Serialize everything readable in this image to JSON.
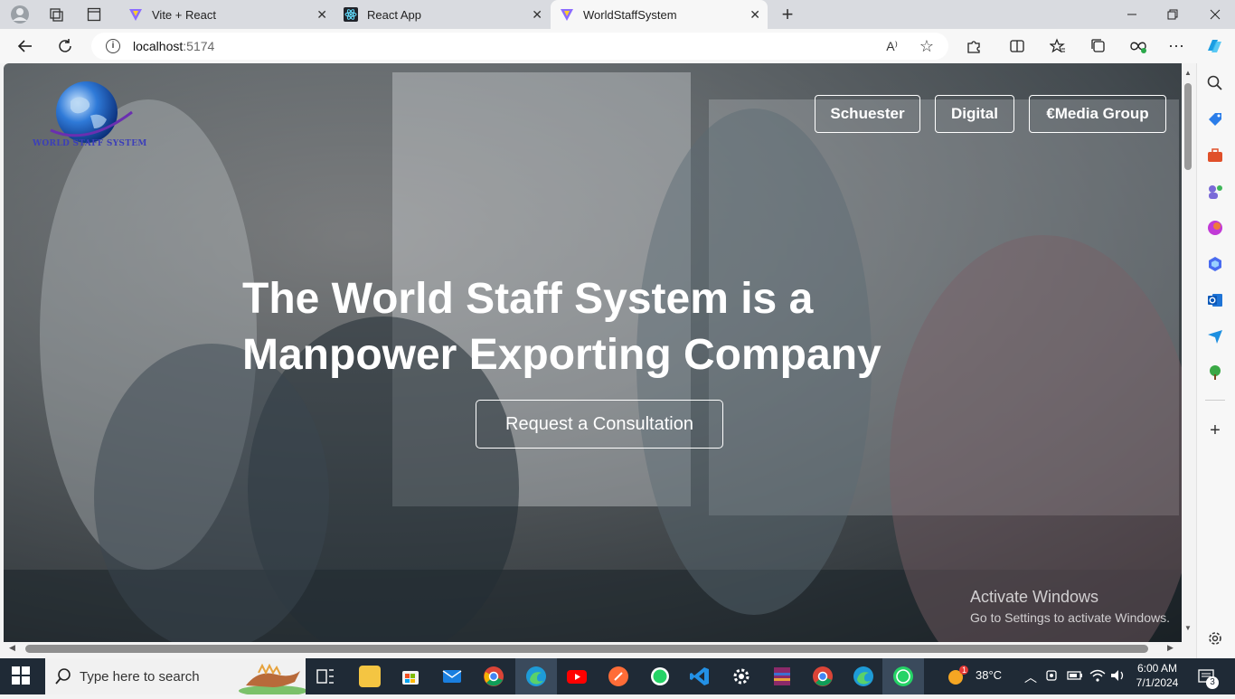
{
  "browser": {
    "tabs": [
      {
        "label": "Vite + React",
        "active": false
      },
      {
        "label": "React App",
        "active": false
      },
      {
        "label": "WorldStaffSystem",
        "active": true
      }
    ],
    "new_tab": "+",
    "url_host": "localhost",
    "url_port": ":5174",
    "read_aloud": "A⁾"
  },
  "page": {
    "logo_text": "WORLD STAFF SYSTEM",
    "nav": [
      "Schuester",
      "Digital",
      "€Media Group"
    ],
    "headline_line1": "The World Staff System is a",
    "headline_line2": "Manpower Exporting Company",
    "cta": "Request a Consultation"
  },
  "watermark": {
    "title": "Activate Windows",
    "subtitle": "Go to Settings to activate Windows."
  },
  "taskbar": {
    "search_placeholder": "Type here to search",
    "temperature": "38°C",
    "time": "6:00 AM",
    "date": "7/1/2024",
    "notifications": "3",
    "weather_badge": "1"
  },
  "colors": {
    "accent_logo": "#3c3fb8",
    "taskbar": "#1f2a36"
  }
}
